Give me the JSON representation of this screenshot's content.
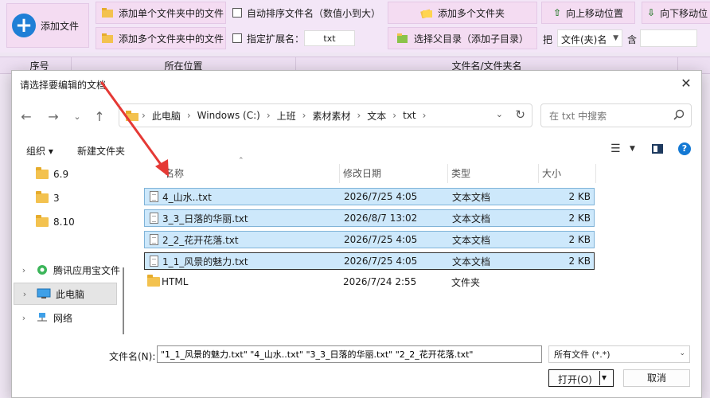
{
  "app_toolbar": {
    "add_file": "添加文件",
    "add_single_folder_files": "添加单个文件夹中的文件",
    "add_multi_folder_files": "添加多个文件夹中的文件",
    "auto_sort": "自动排序文件名（数值小到大）",
    "specify_ext": "指定扩展名：",
    "ext_value": "txt",
    "add_multi_folders": "添加多个文件夹",
    "select_parent_dir": "选择父目录（添加子目录）",
    "move_up": "向上移动位置",
    "move_down": "向下移动位",
    "put_label": "把",
    "put_select": "文件(夹)名",
    "contain_label": "含"
  },
  "app_table": {
    "col_index": "序号",
    "col_location": "所在位置",
    "col_name": "文件名/文件夹名"
  },
  "dialog": {
    "title": "请选择要编辑的文档",
    "breadcrumbs": [
      "此电脑",
      "Windows (C:)",
      "上班",
      "素材素材",
      "文本",
      "txt"
    ],
    "search_placeholder": "在 txt 中搜索",
    "organize": "组织 ▾",
    "new_folder": "新建文件夹",
    "nav": {
      "folders": [
        "6.9",
        "3",
        "8.10"
      ],
      "tencent": "腾讯应用宝文件",
      "this_pc": "此电脑",
      "network": "网络"
    },
    "columns": {
      "name": "名称",
      "modified": "修改日期",
      "type": "类型",
      "size": "大小"
    },
    "files": [
      {
        "name": "4_山水..txt",
        "modified": "2026/7/25 4:05",
        "type": "文本文档",
        "size": "2 KB"
      },
      {
        "name": "3_3_日落的华丽.txt",
        "modified": "2026/8/7 13:02",
        "type": "文本文档",
        "size": "2 KB"
      },
      {
        "name": "2_2_花开花落.txt",
        "modified": "2026/7/25 4:05",
        "type": "文本文档",
        "size": "2 KB"
      },
      {
        "name": "1_1_风景的魅力.txt",
        "modified": "2026/7/25 4:05",
        "type": "文本文档",
        "size": "2 KB"
      }
    ],
    "folder_row": {
      "name": "HTML",
      "modified": "2026/7/24 2:55",
      "type": "文件夹"
    },
    "filename_label": "文件名(N):",
    "filename_value": "\"1_1_风景的魅力.txt\" \"4_山水..txt\" \"3_3_日落的华丽.txt\" \"2_2_花开花落.txt\"",
    "filetype": "所有文件 (*.*)",
    "open": "打开(O)",
    "cancel": "取消"
  },
  "colors": {
    "selection": "#cde8fb",
    "selection_border": "#7fb3d8",
    "arrow": "#e53935",
    "toolbar_bg": "#f3e6f7"
  }
}
